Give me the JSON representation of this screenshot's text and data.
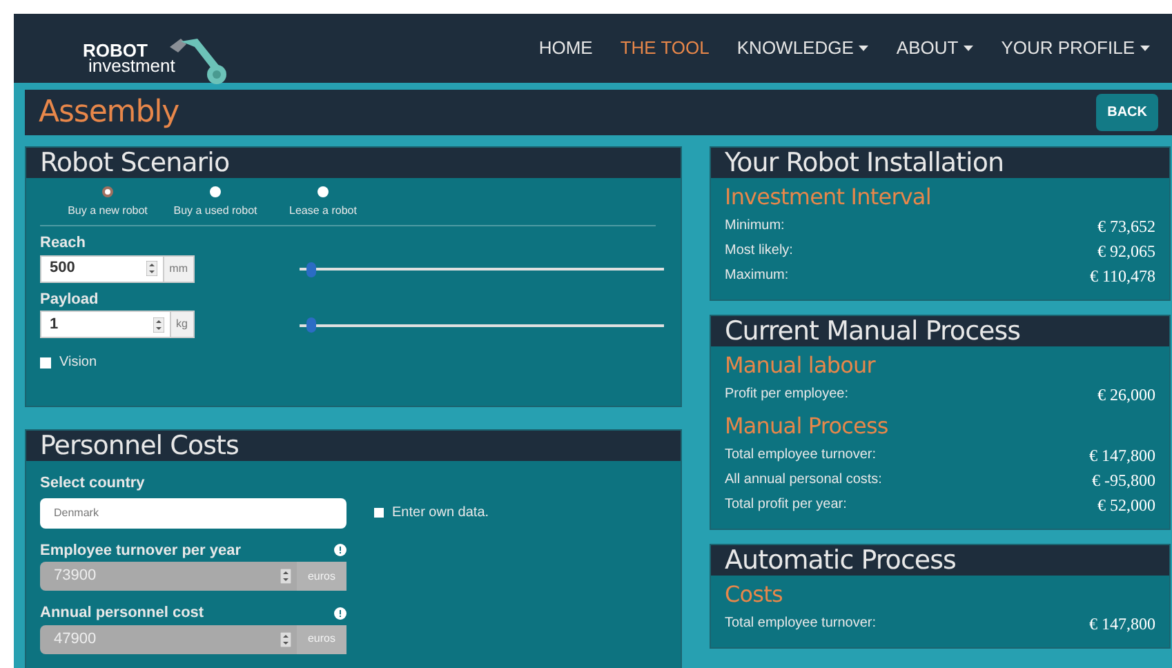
{
  "nav": {
    "logo_top": "ROBOT",
    "logo_bottom": "investment",
    "items": [
      {
        "label": "HOME",
        "selected": false,
        "dropdown": false
      },
      {
        "label": "THE TOOL",
        "selected": true,
        "dropdown": false
      },
      {
        "label": "KNOWLEDGE",
        "selected": false,
        "dropdown": true
      },
      {
        "label": "ABOUT",
        "selected": false,
        "dropdown": true
      },
      {
        "label": "YOUR PROFILE",
        "selected": false,
        "dropdown": true
      }
    ]
  },
  "page": {
    "title": "Assembly",
    "back": "BACK"
  },
  "robot_scenario": {
    "title": "Robot Scenario",
    "options": [
      {
        "label": "Buy a new robot",
        "selected": true
      },
      {
        "label": "Buy a used robot",
        "selected": false
      },
      {
        "label": "Lease a robot",
        "selected": false
      }
    ],
    "fields": [
      {
        "label": "Reach",
        "value": "500",
        "unit": "mm",
        "level": 0.02
      },
      {
        "label": "Payload",
        "value": "1",
        "unit": "kg",
        "level": 0.02
      }
    ],
    "vision": {
      "label": "Vision",
      "checked": false
    }
  },
  "personnel": {
    "title": "Personnel Costs",
    "country_label": "Select country",
    "country": "Denmark",
    "own_data": {
      "label": "Enter own data.",
      "checked": false
    },
    "fields": [
      {
        "label": "Employee turnover per year",
        "value": "73900",
        "unit": "euros",
        "disabled": true
      },
      {
        "label": "Annual personnel cost",
        "value": "47900",
        "unit": "euros",
        "disabled": true
      }
    ]
  },
  "results": [
    {
      "title": "Your Robot Installation",
      "sections": [
        {
          "heading": "Investment Interval",
          "rows": [
            {
              "label": "Minimum:",
              "value": "€ 73,652"
            },
            {
              "label": "Most likely:",
              "value": "€ 92,065"
            },
            {
              "label": "Maximum:",
              "value": "€ 110,478"
            }
          ]
        }
      ]
    },
    {
      "title": "Current Manual Process",
      "sections": [
        {
          "heading": "Manual labour",
          "rows": [
            {
              "label": "Profit per employee:",
              "value": "€ 26,000"
            }
          ]
        },
        {
          "heading": "Manual Process",
          "rows": [
            {
              "label": "Total employee turnover:",
              "value": "€ 147,800"
            },
            {
              "label": "All annual personal costs:",
              "value": "€ -95,800"
            },
            {
              "label": "Total profit per year:",
              "value": "€ 52,000"
            }
          ]
        }
      ]
    },
    {
      "title": "Automatic Process",
      "sections": [
        {
          "heading": "Costs",
          "rows": [
            {
              "label": "Total employee turnover:",
              "value": "€ 147,800"
            }
          ]
        }
      ]
    }
  ]
}
